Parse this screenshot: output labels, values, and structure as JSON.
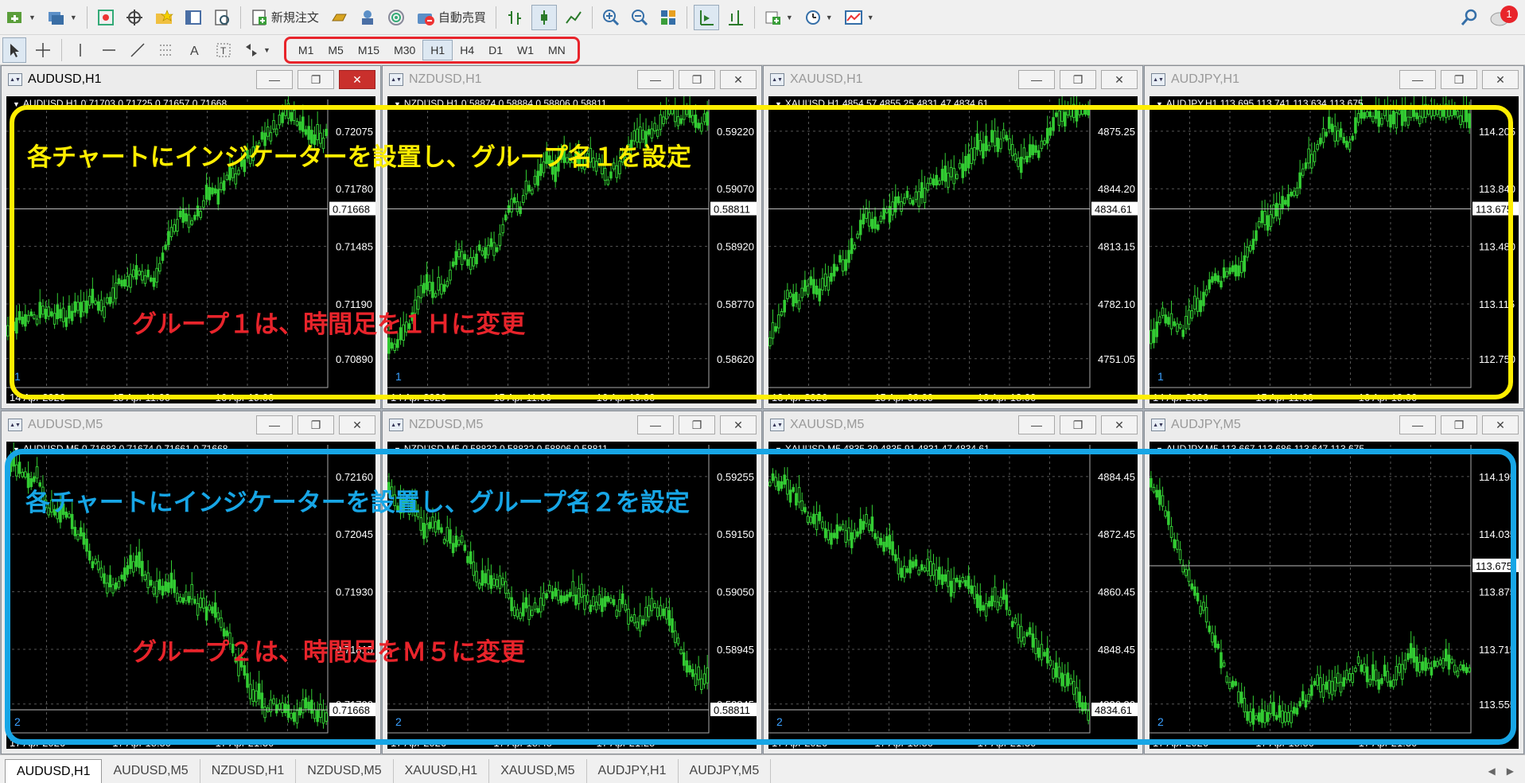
{
  "toolbar": {
    "new_order_label": "新規注文",
    "auto_trade_label": "自動売買",
    "notification_count": "1",
    "timeframes": [
      "M1",
      "M5",
      "M15",
      "M30",
      "H1",
      "H4",
      "D1",
      "W1",
      "MN"
    ],
    "active_timeframe": "H1"
  },
  "charts": [
    {
      "title": "AUDUSD,H1",
      "active": true,
      "info": "AUDUSD,H1  0.71703 0.71725 0.71657 0.71668",
      "group": "1",
      "prices": [
        "0.72075",
        "0.71780",
        "0.71485",
        "0.71190",
        "0.70890"
      ],
      "current": "0.71668",
      "dates": [
        "14 Apr 2026",
        "15 Apr 11:00",
        "16 Apr 19:00"
      ],
      "trend": "up"
    },
    {
      "title": "NZDUSD,H1",
      "active": false,
      "info": "NZDUSD,H1  0.58874 0.58884 0.58806 0.58811",
      "group": "1",
      "prices": [
        "0.59220",
        "0.59070",
        "0.58920",
        "0.58770",
        "0.58620"
      ],
      "current": "0.58811",
      "dates": [
        "14 Apr 2026",
        "15 Apr 11:00",
        "16 Apr 19:00"
      ],
      "trend": "up"
    },
    {
      "title": "XAUUSD,H1",
      "active": false,
      "info": "XAUUSD,H1  4854.57 4855.25 4831.47 4834.61",
      "group": "",
      "prices": [
        "4875.25",
        "4844.20",
        "4813.15",
        "4782.10",
        "4751.05"
      ],
      "current": "4834.61",
      "dates": [
        "13 Apr 2026",
        "15 Apr 09:00",
        "16 Apr 18:00"
      ],
      "trend": "up"
    },
    {
      "title": "AUDJPY,H1",
      "active": false,
      "info": "AUDJPY,H1  113.695 113.741 113.634 113.675",
      "group": "1",
      "prices": [
        "114.205",
        "113.840",
        "113.480",
        "113.115",
        "112.750"
      ],
      "current": "113.675",
      "dates": [
        "14 Apr 2026",
        "15 Apr 11:00",
        "16 Apr 19:00"
      ],
      "trend": "up"
    },
    {
      "title": "AUDUSD,M5",
      "active": false,
      "info": "AUDUSD,M5  0.71683 0.71674 0.71661 0.71668",
      "group": "2",
      "prices": [
        "0.72160",
        "0.72045",
        "0.71930",
        "0.71815",
        "0.71700"
      ],
      "current": "0.71668",
      "dates": [
        "17 Apr 2026",
        "17 Apr 18:50",
        "17 Apr 21:30"
      ],
      "trend": "down"
    },
    {
      "title": "NZDUSD,M5",
      "active": false,
      "info": "NZDUSD,M5  0.58832 0.58832 0.58806 0.58811",
      "group": "2",
      "prices": [
        "0.59255",
        "0.59150",
        "0.59050",
        "0.58945",
        "0.58845"
      ],
      "current": "0.58811",
      "dates": [
        "17 Apr 2026",
        "17 Apr 18:45",
        "17 Apr 21:25"
      ],
      "trend": "down"
    },
    {
      "title": "XAUUSD,M5",
      "active": false,
      "info": "XAUUSD,M5  4835.39 4835.91 4831.47 4834.61",
      "group": "2",
      "prices": [
        "4884.45",
        "4872.45",
        "4860.45",
        "4848.45",
        "4836.30"
      ],
      "current": "4834.61",
      "dates": [
        "17 Apr 2026",
        "17 Apr 18:50",
        "17 Apr 21:30"
      ],
      "trend": "down"
    },
    {
      "title": "AUDJPY,M5",
      "active": false,
      "info": "AUDJPY,M5  113.667 113.686 113.647 113.675",
      "group": "2",
      "prices": [
        "114.195",
        "114.035",
        "113.875",
        "113.715",
        "113.555"
      ],
      "current": "113.675",
      "dates": [
        "17 Apr 2026",
        "17 Apr 18:50",
        "17 Apr 21:30"
      ],
      "trend": "downflat"
    }
  ],
  "annotations": {
    "group1_setup": "各チャートにインジケーターを設置し、グループ名１を設定",
    "group1_change": "グループ１は、時間足を１Ｈに変更",
    "group2_setup": "各チャートにインジケーターを設置し、グループ名２を設定",
    "group2_change": "グループ２は、時間足をＭ５に変更"
  },
  "tabs": [
    "AUDUSD,H1",
    "AUDUSD,M5",
    "NZDUSD,H1",
    "NZDUSD,M5",
    "XAUUSD,H1",
    "XAUUSD,M5",
    "AUDJPY,H1",
    "AUDJPY,M5"
  ],
  "active_tab": "AUDUSD,H1",
  "colors": {
    "candle": "#33cc33",
    "chart_bg": "#000000",
    "yellow_annotation": "#ffee00",
    "blue_annotation": "#17a6e6",
    "red_annotation": "#e8242b"
  }
}
